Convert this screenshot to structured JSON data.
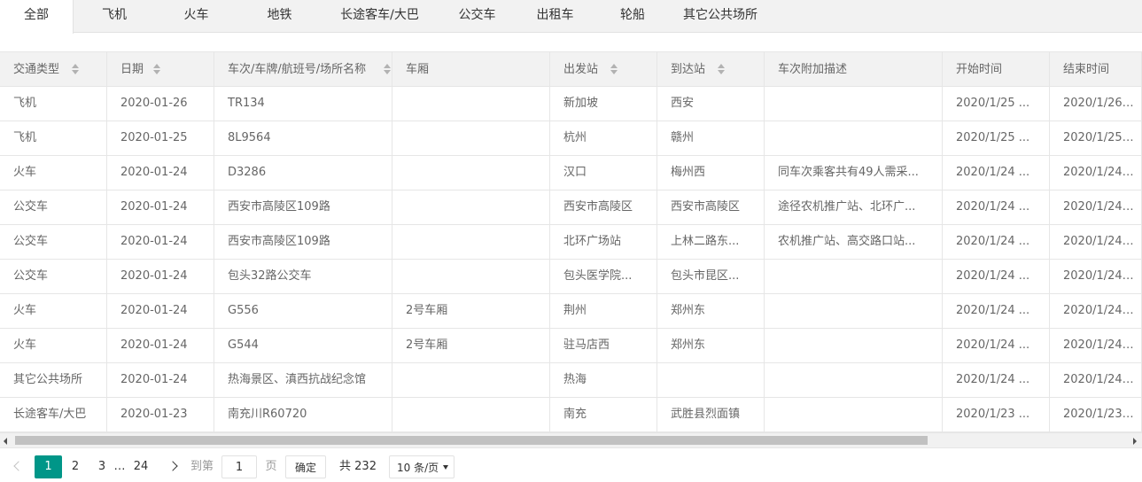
{
  "tabs": [
    "全部",
    "飞机",
    "火车",
    "地铁",
    "长途客车/大巴",
    "公交车",
    "出租车",
    "轮船",
    "其它公共场所"
  ],
  "active_tab": 0,
  "table": {
    "headers": [
      "交通类型",
      "日期",
      "车次/车牌/航班号/场所名称",
      "车厢",
      "出发站",
      "到达站",
      "车次附加描述",
      "开始时间",
      "结束时间"
    ],
    "sortable": [
      true,
      true,
      true,
      false,
      true,
      true,
      false,
      false,
      false
    ],
    "rows": [
      [
        "飞机",
        "2020-01-26",
        "TR134",
        "",
        "新加坡",
        "西安",
        "",
        "2020/1/25 ...",
        "2020/1/26 ..."
      ],
      [
        "飞机",
        "2020-01-25",
        "8L9564",
        "",
        "杭州",
        "赣州",
        "",
        "2020/1/25 ...",
        "2020/1/25 ..."
      ],
      [
        "火车",
        "2020-01-24",
        "D3286",
        "",
        "汉口",
        "梅州西",
        "同车次乘客共有49人需采...",
        "2020/1/24 ...",
        "2020/1/24 ..."
      ],
      [
        "公交车",
        "2020-01-24",
        "西安市高陵区109路",
        "",
        "西安市高陵区",
        "西安市高陵区",
        "途径农机推广站、北环广...",
        "2020/1/24 ...",
        "2020/1/24 ..."
      ],
      [
        "公交车",
        "2020-01-24",
        "西安市高陵区109路",
        "",
        "北环广场站",
        "上林二路东...",
        "农机推广站、高交路口站...",
        "2020/1/24 ...",
        "2020/1/24 ..."
      ],
      [
        "公交车",
        "2020-01-24",
        "包头32路公交车",
        "",
        "包头医学院...",
        "包头市昆区...",
        "",
        "2020/1/24 ...",
        "2020/1/24 ..."
      ],
      [
        "火车",
        "2020-01-24",
        "G556",
        "2号车厢",
        "荆州",
        "郑州东",
        "",
        "2020/1/24 ...",
        "2020/1/24 ..."
      ],
      [
        "火车",
        "2020-01-24",
        "G544",
        "2号车厢",
        "驻马店西",
        "郑州东",
        "",
        "2020/1/24 ...",
        "2020/1/24 ..."
      ],
      [
        "其它公共场所",
        "2020-01-24",
        "热海景区、滇西抗战纪念馆",
        "",
        "热海",
        "",
        "",
        "2020/1/24 ...",
        "2020/1/24 ..."
      ],
      [
        "长途客车/大巴",
        "2020-01-23",
        "南充川R60720",
        "",
        "南充",
        "武胜县烈面镇",
        "",
        "2020/1/23 ...",
        "2020/1/23 ..."
      ]
    ]
  },
  "pager": {
    "current": "1",
    "pages": [
      "2",
      "3"
    ],
    "ellipsis": "…",
    "last": "24",
    "goto_label": "到第",
    "goto_value": "1",
    "page_label": "页",
    "confirm": "确定",
    "total": "共 232 条",
    "page_size": "10 条/页"
  },
  "colors": {
    "accent": "#009688",
    "header_bg": "#f2f2f2",
    "border": "#e6e6e6"
  }
}
